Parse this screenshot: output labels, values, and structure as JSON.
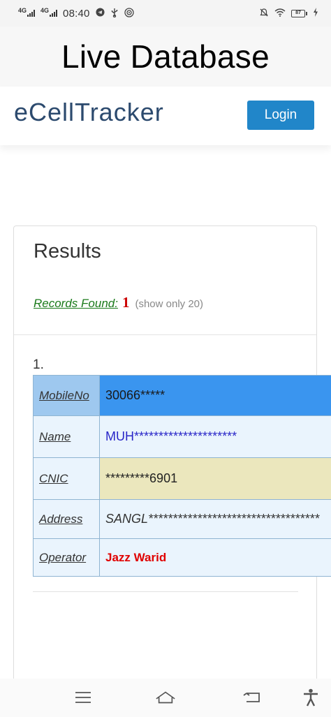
{
  "status_bar": {
    "network_1": "4G",
    "network_2": "4G",
    "time": "08:40",
    "battery_level": "87"
  },
  "banner": {
    "title": "Live Database"
  },
  "navbar": {
    "brand": "eCellTracker",
    "login_label": "Login"
  },
  "results": {
    "title": "Results",
    "records_found_label": "Records Found:",
    "records_count": "1",
    "records_note": "(show only 20)",
    "item_number": "1.",
    "record": [
      {
        "key": "MobileNo",
        "value": "30066*****"
      },
      {
        "key": "Name",
        "value": "MUH*********************"
      },
      {
        "key": "CNIC",
        "value": "*********6901"
      },
      {
        "key": "Address",
        "value": "SANGL***********************************"
      },
      {
        "key": "Operator",
        "value": "Jazz Warid"
      }
    ]
  },
  "icons": {
    "status": [
      "signal-icon",
      "telegram-icon",
      "usb-icon",
      "hotspot-icon",
      "mute-icon",
      "wifi-icon",
      "battery-icon",
      "charging-icon"
    ],
    "system_nav": [
      "menu-icon",
      "home-icon",
      "back-icon",
      "accessibility-icon"
    ]
  },
  "colors": {
    "login_button": "#2186c9",
    "brand": "#2c4a6e",
    "mobile_row_value_bg": "#3a95ef",
    "name_value": "#2a27c8",
    "cnic_value_bg": "#ebe7bd",
    "operator_value": "#e00000",
    "records_found_label": "#1a7a1a",
    "records_count": "#cc0000"
  }
}
